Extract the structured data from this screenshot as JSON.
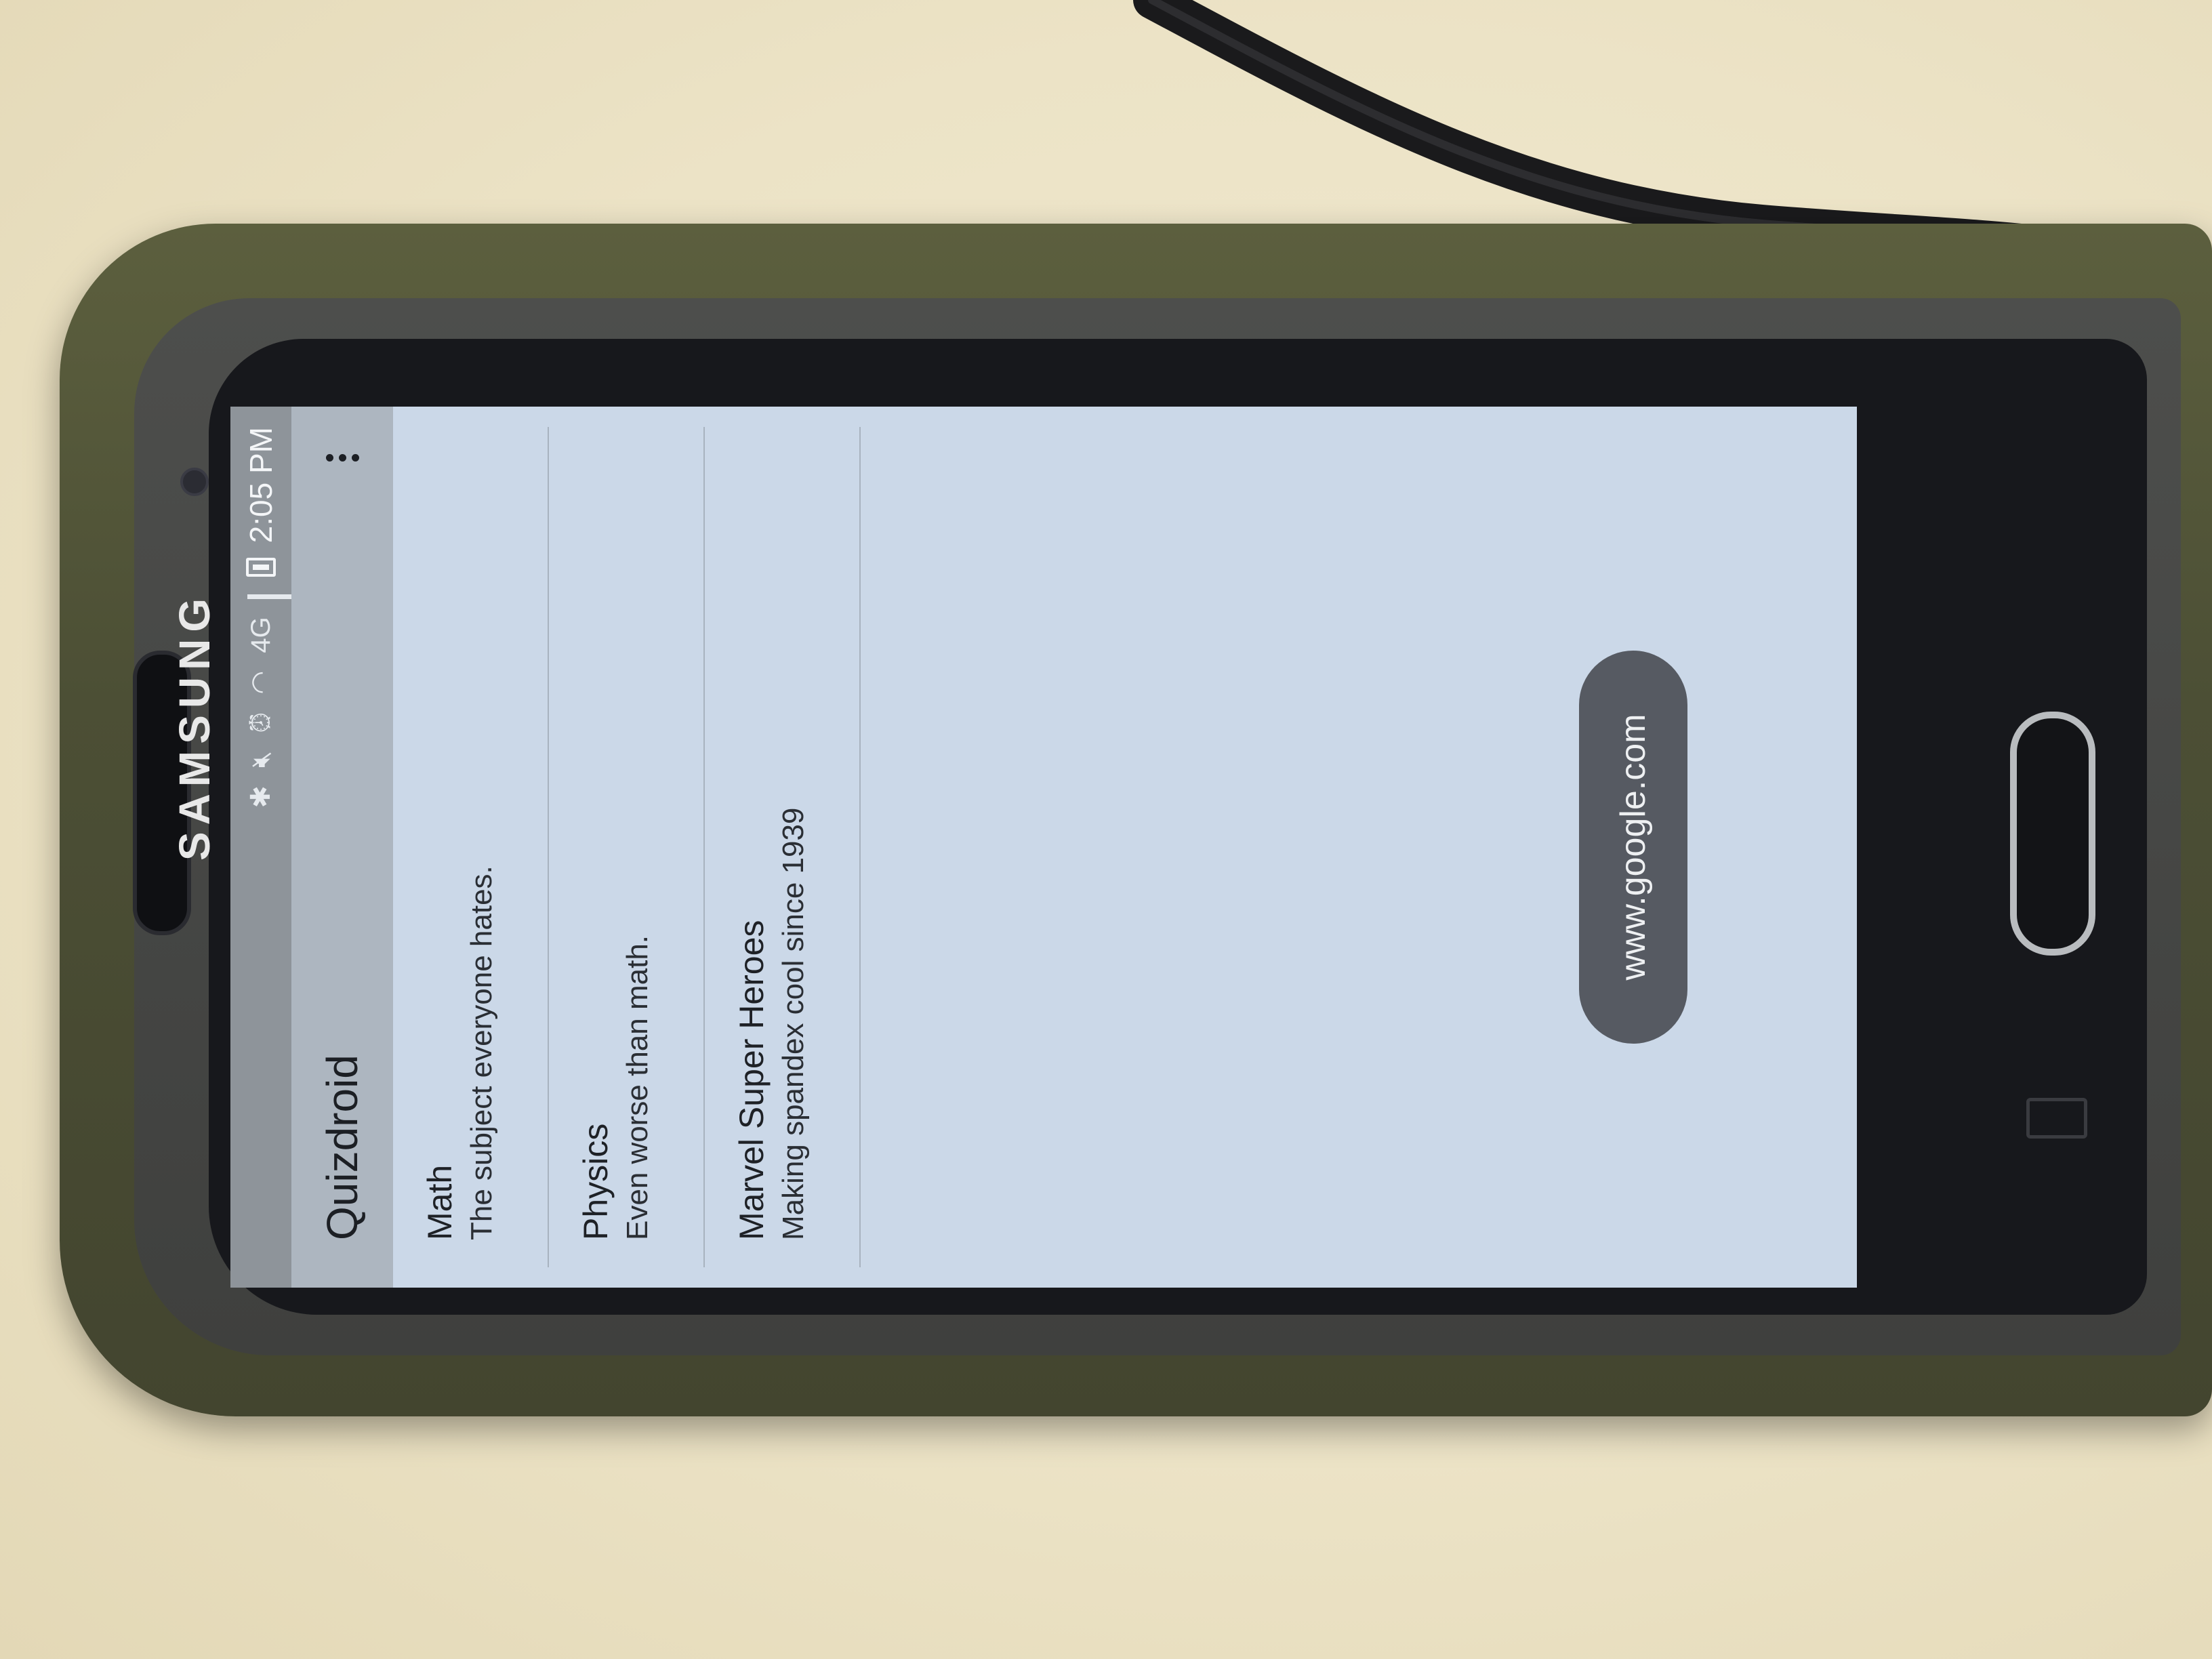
{
  "device": {
    "brand": "SAMSUNG"
  },
  "status_bar": {
    "time": "2:05 PM",
    "network": "4G"
  },
  "action_bar": {
    "title": "Quizdroid"
  },
  "quiz_list": [
    {
      "title": "Math",
      "subtitle": "The subject everyone hates."
    },
    {
      "title": "Physics",
      "subtitle": "Even worse than math."
    },
    {
      "title": "Marvel Super Heroes",
      "subtitle": "Making spandex cool since 1939"
    }
  ],
  "toast": {
    "text": "www.google.com"
  },
  "colors": {
    "screen_background": "#cbd8e8",
    "action_bar": "#adb6c0",
    "status_bar": "#8e949a",
    "toast": "#565a62",
    "case": "#4c4f35"
  },
  "icons": [
    "bluetooth-icon",
    "mute-icon",
    "alarm-icon",
    "wifi-icon",
    "signal-icon",
    "battery-charging-icon",
    "overflow-menu-icon"
  ]
}
